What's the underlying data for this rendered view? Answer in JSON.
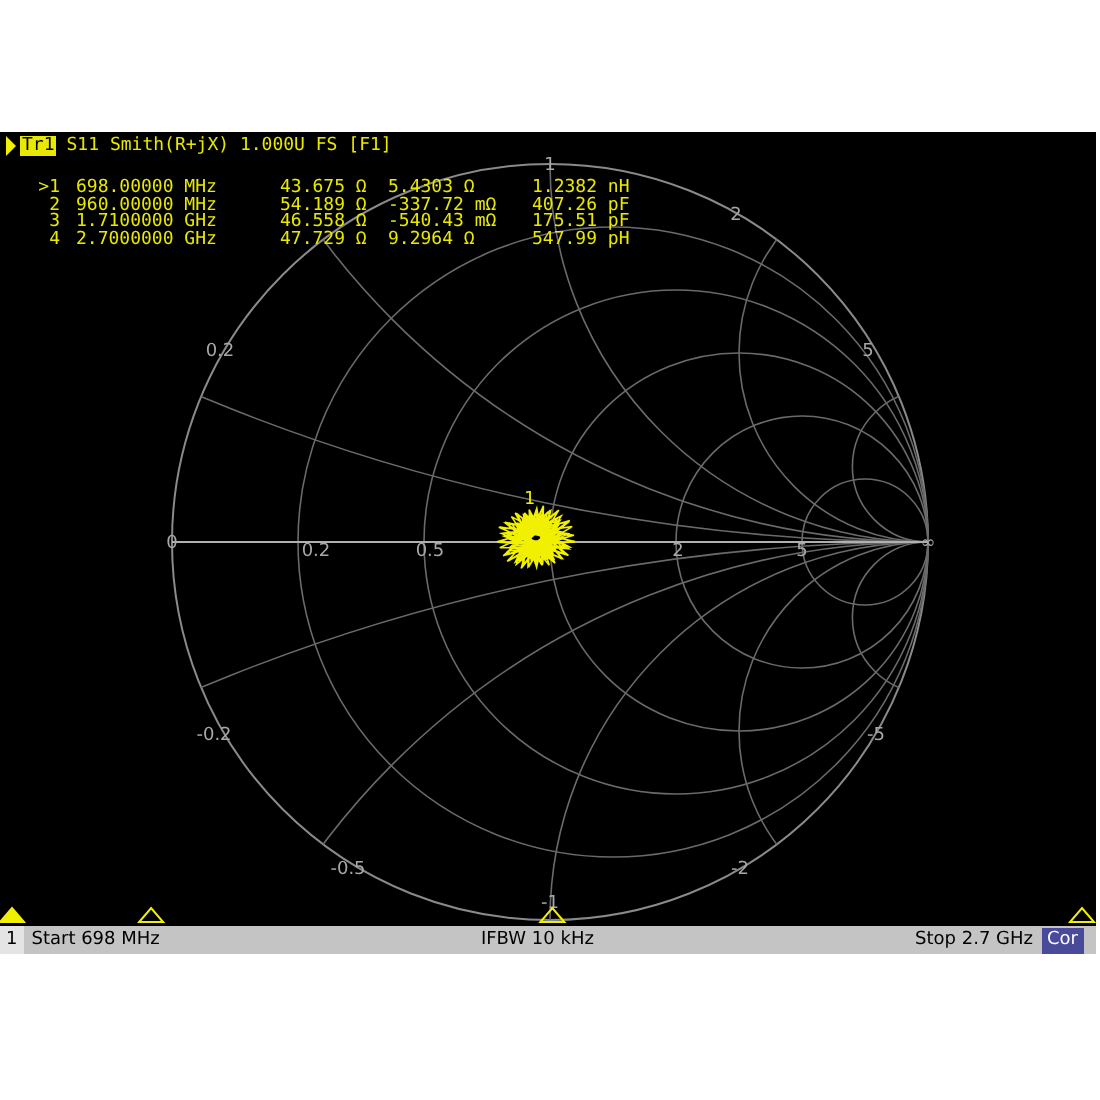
{
  "trace_header": {
    "tag": "Tr1",
    "title": "S11 Smith(R+jX) 1.000U FS [F1]"
  },
  "marker_table": [
    {
      "marker": ">1",
      "frequency": "698.00000 MHz",
      "resistance": "43.675 Ω",
      "reactance": "5.4303 Ω",
      "component": "1.2382 nH",
      "selected": true
    },
    {
      "marker": "2",
      "frequency": "960.00000 MHz",
      "resistance": "54.189 Ω",
      "reactance": "-337.72 mΩ",
      "component": "407.26 pF",
      "selected": false
    },
    {
      "marker": "3",
      "frequency": "1.7100000 GHz",
      "resistance": "46.558 Ω",
      "reactance": "-540.43 mΩ",
      "component": "175.51 pF",
      "selected": false
    },
    {
      "marker": "4",
      "frequency": "2.7000000 GHz",
      "resistance": "47.729 Ω",
      "reactance": "9.2964 Ω",
      "component": "547.99 pH",
      "selected": false
    }
  ],
  "smith_labels": [
    "1",
    "2",
    "5",
    "0.2",
    "0",
    "0.2",
    "0.5",
    "2",
    "5",
    "∞",
    "-0.2",
    "-0.5",
    "-1",
    "-2",
    "-5"
  ],
  "trace_marker_label": "1",
  "status_bar": {
    "channel": "1",
    "start": "Start 698 MHz",
    "ifbw": "IFBW 10 kHz",
    "stop": "Stop 2.7 GHz",
    "correction": "Cor"
  }
}
